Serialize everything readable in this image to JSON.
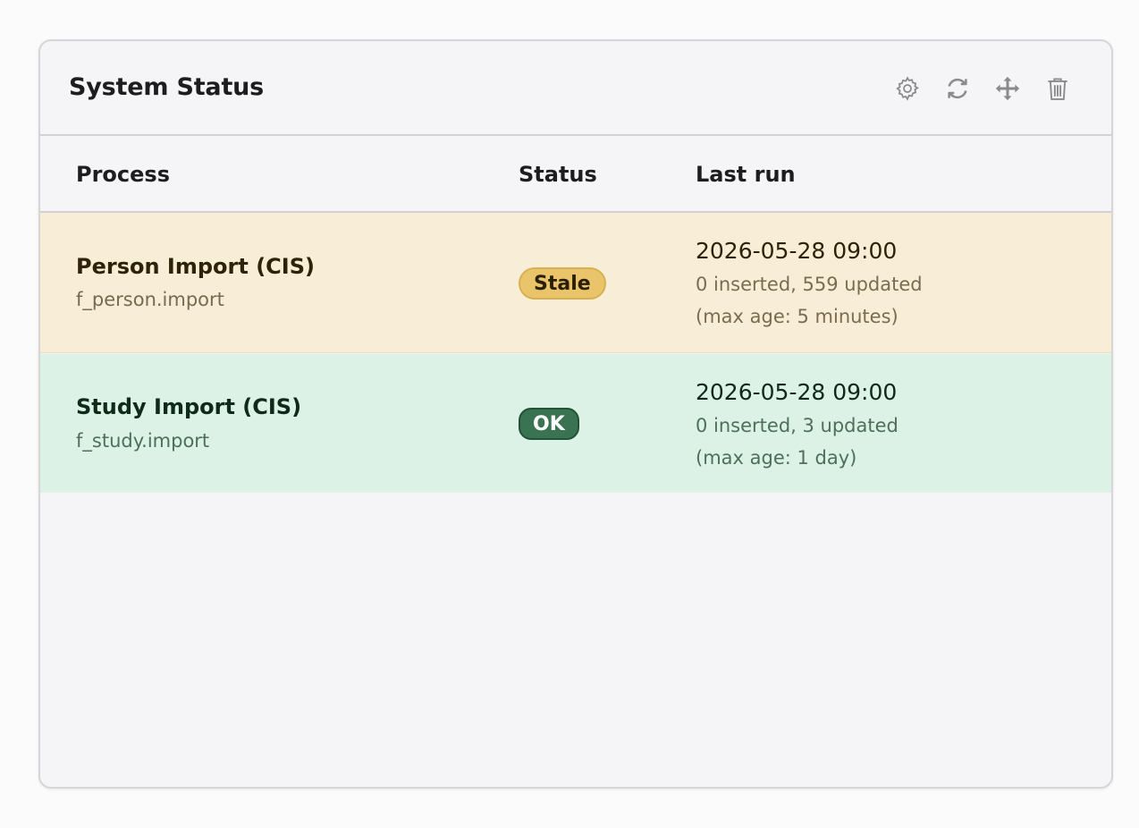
{
  "widget": {
    "title": "System Status",
    "toolbar": {
      "settings_icon": "gear-icon",
      "refresh_icon": "refresh-icon",
      "move_icon": "move-icon",
      "delete_icon": "trash-icon"
    }
  },
  "table": {
    "headers": {
      "process": "Process",
      "status": "Status",
      "last_run": "Last run"
    },
    "rows": [
      {
        "name": "Person Import (CIS)",
        "id": "f_person.import",
        "status": "Stale",
        "status_color": "#e9c46a",
        "row_color": "#f8eed8",
        "last_run_date": "2026-05-28 09:00",
        "counts": "0 inserted, 559 updated",
        "max_age": "(max age: 5 minutes)"
      },
      {
        "name": "Study Import (CIS)",
        "id": "f_study.import",
        "status": "OK",
        "status_color": "#3a7352",
        "row_color": "#dcf2e6",
        "last_run_date": "2026-05-28 09:00",
        "counts": "0 inserted, 3 updated",
        "max_age": "(max age: 1 day)"
      }
    ]
  }
}
